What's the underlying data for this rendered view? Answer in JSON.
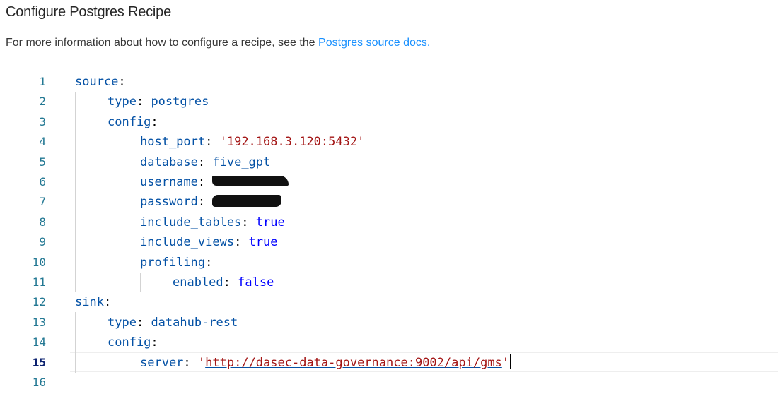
{
  "header": {
    "title": "Configure Postgres Recipe",
    "description_prefix": "For more information about how to configure a recipe, see the ",
    "docs_link": "Postgres source docs."
  },
  "editor": {
    "active_line": 15,
    "line_numbers": [
      "1",
      "2",
      "3",
      "4",
      "5",
      "6",
      "7",
      "8",
      "9",
      "10",
      "11",
      "12",
      "13",
      "14",
      "15",
      "16"
    ],
    "lines": {
      "l1_key": "source",
      "l2_key": "type",
      "l2_val": "postgres",
      "l3_key": "config",
      "l4_key": "host_port",
      "l4_val": "'192.168.3.120:5432'",
      "l5_key": "database",
      "l5_val": "five_gpt",
      "l6_key": "username",
      "l7_key": "password",
      "l8_key": "include_tables",
      "l8_val": "true",
      "l9_key": "include_views",
      "l9_val": "true",
      "l10_key": "profiling",
      "l11_key": "enabled",
      "l11_val": "false",
      "l12_key": "sink",
      "l13_key": "type",
      "l13_val": "datahub-rest",
      "l14_key": "config",
      "l15_key": "server",
      "l15_quote_open": "'",
      "l15_val": "http://dasec-data-governance:9002/api/gms",
      "l15_quote_close": "'"
    }
  },
  "colors": {
    "link": "#1890ff",
    "yaml_key": "#0451a5",
    "yaml_bool": "#0000ff",
    "yaml_string": "#a31515",
    "line_number": "#237893",
    "active_line_number": "#0b216f"
  }
}
